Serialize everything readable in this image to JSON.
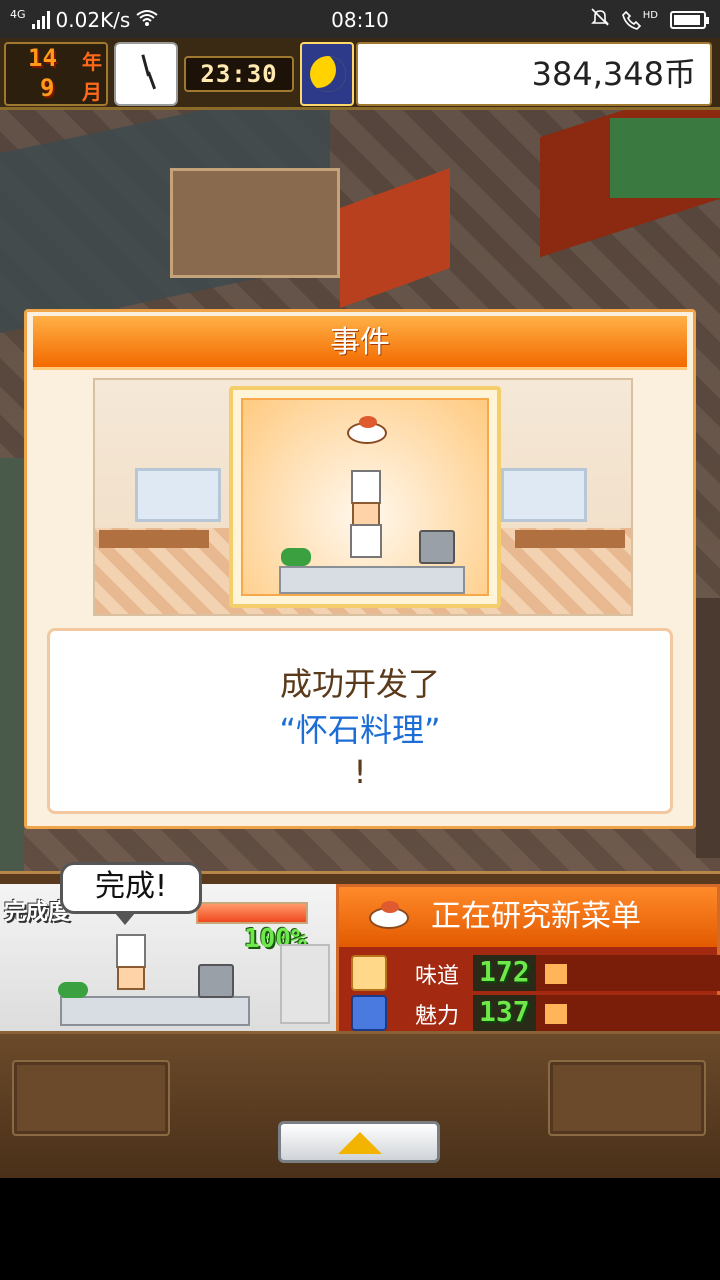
{
  "status_bar": {
    "network": "4G",
    "speed": "0.02K/s",
    "time": "08:10",
    "hd": "HD"
  },
  "hud": {
    "year_value": "14",
    "year_unit": "年",
    "month_value": "9",
    "month_unit": "月",
    "clock_time": "23:30",
    "money": "384,348币",
    "time_of_day_icon": "moon-icon"
  },
  "event_dialog": {
    "title": "事件",
    "line1": "成功开发了",
    "dish_name": "“怀石料理”",
    "line3": "!"
  },
  "kitchen": {
    "status_label": "完成度",
    "progress_percent": "100%",
    "progress_value": 100,
    "bubble": "完成!"
  },
  "research": {
    "title": "正在研究新菜单",
    "stats": [
      {
        "name": "味道",
        "value": "172",
        "icon": "taste-icon"
      },
      {
        "name": "魅力",
        "value": "137",
        "icon": "charm-icon"
      }
    ]
  },
  "colors": {
    "accent_orange": "#f26a00",
    "dish_blue": "#1d6dd6",
    "stat_green": "#6ee84a"
  }
}
